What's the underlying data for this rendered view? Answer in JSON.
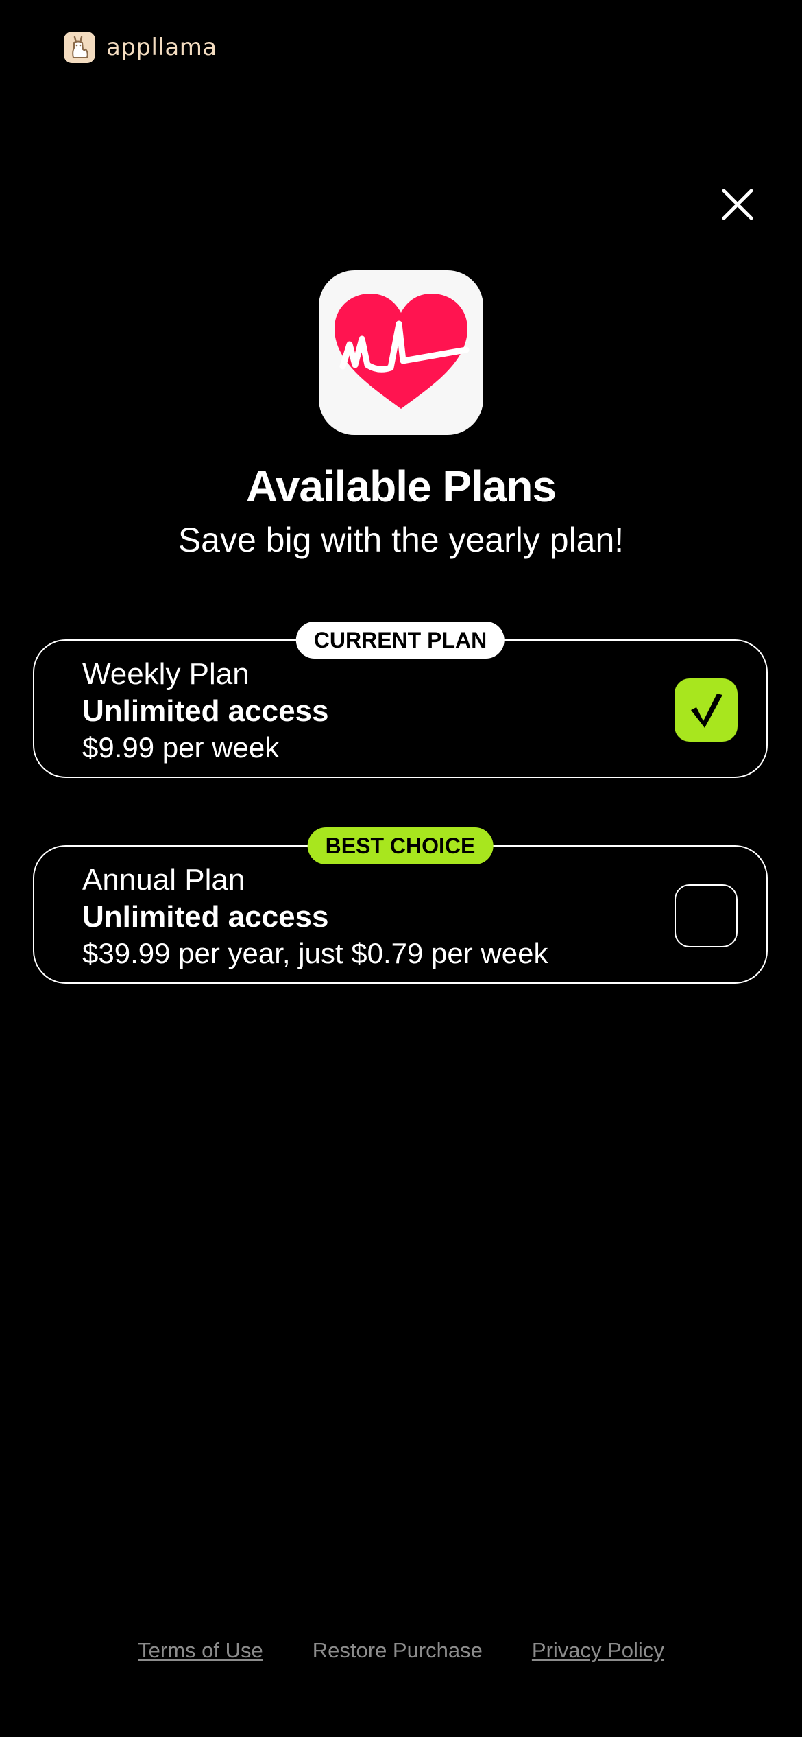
{
  "brand": {
    "name": "appllama",
    "icon": "llama-icon",
    "color": "#f3dcc0"
  },
  "header": {
    "close_icon": "close-icon"
  },
  "app": {
    "icon": "heart-pulse-icon",
    "accent": "#ff1450"
  },
  "main": {
    "title": "Available Plans",
    "subtitle": "Save big with the yearly plan!"
  },
  "plans": [
    {
      "badge": "CURRENT PLAN",
      "badge_color": "#ffffff",
      "name": "Weekly Plan",
      "access": "Unlimited access",
      "price": "$9.99 per week",
      "selected": true
    },
    {
      "badge": "BEST CHOICE",
      "badge_color": "#a8e61e",
      "name": "Annual Plan",
      "access": "Unlimited access",
      "price": "$39.99 per year, just $0.79 per week",
      "selected": false
    }
  ],
  "checkbox": {
    "checked_glyph": "√",
    "check_color": "#a8e61e"
  },
  "footer": {
    "terms": "Terms of Use",
    "restore": "Restore Purchase",
    "privacy": "Privacy Policy"
  }
}
